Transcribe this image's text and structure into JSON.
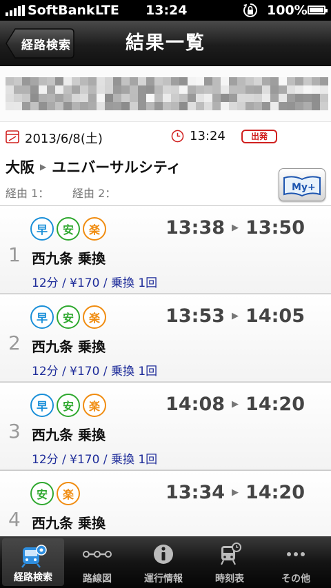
{
  "status_bar": {
    "carrier": "SoftBank",
    "network": "LTE",
    "time": "13:24",
    "battery": "100%",
    "icons": [
      "signal-icon",
      "rotation-lock-icon",
      "battery-icon"
    ]
  },
  "nav": {
    "back_label": "経路検索",
    "title": "結果一覧"
  },
  "summary": {
    "date": "2013/6/8(土)",
    "time": "13:24",
    "depart_badge": "出発",
    "from": "大阪",
    "to": "ユニバーサルシティ",
    "via1": "経由 1：",
    "via2": "経由 2：",
    "my_button": "My+"
  },
  "results": [
    {
      "num": "1",
      "badges": [
        "早",
        "安",
        "楽"
      ],
      "dep": "13:38",
      "arr": "13:50",
      "transfer": "西九条 乗換",
      "detail": "12分 / ¥170 / 乗換 1回"
    },
    {
      "num": "2",
      "badges": [
        "早",
        "安",
        "楽"
      ],
      "dep": "13:53",
      "arr": "14:05",
      "transfer": "西九条 乗換",
      "detail": "12分 / ¥170 / 乗換 1回"
    },
    {
      "num": "3",
      "badges": [
        "早",
        "安",
        "楽"
      ],
      "dep": "14:08",
      "arr": "14:20",
      "transfer": "西九条 乗換",
      "detail": "12分 / ¥170 / 乗換 1回"
    },
    {
      "num": "4",
      "badges": [
        "安",
        "楽"
      ],
      "dep": "13:34",
      "arr": "14:20",
      "transfer": "西九条 乗換",
      "detail": ""
    }
  ],
  "tabs": [
    {
      "label": "経路検索",
      "icon": "train-search-icon",
      "active": true
    },
    {
      "label": "路線図",
      "icon": "route-map-icon",
      "active": false
    },
    {
      "label": "運行情報",
      "icon": "info-icon",
      "active": false
    },
    {
      "label": "時刻表",
      "icon": "timetable-icon",
      "active": false
    },
    {
      "label": "その他",
      "icon": "more-icon",
      "active": false
    }
  ],
  "colors": {
    "fast": "#1a8fd8",
    "cheap": "#2fa82f",
    "easy": "#f08c10",
    "depart": "#d0201f",
    "detail_text": "#1f2d9a"
  }
}
